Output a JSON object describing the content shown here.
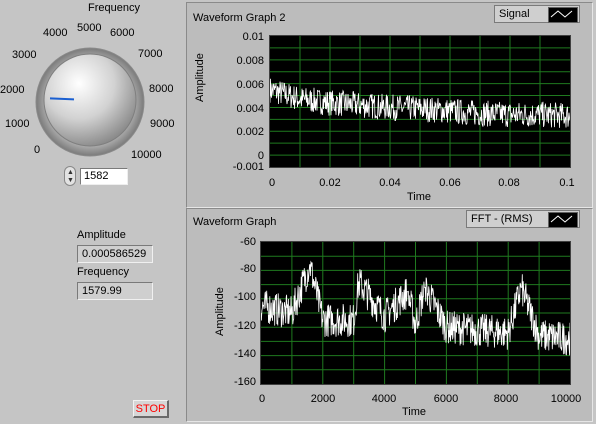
{
  "knob": {
    "label": "Frequency",
    "scale": [
      "0",
      "1000",
      "2000",
      "3000",
      "4000",
      "5000",
      "6000",
      "7000",
      "8000",
      "9000",
      "10000"
    ],
    "value": 1582,
    "control_value": "1582"
  },
  "indicators": {
    "amplitude_label": "Amplitude",
    "amplitude_value": "0.000586529",
    "frequency_label": "Frequency",
    "frequency_value": "1579.99"
  },
  "stop_label": "STOP",
  "graph1": {
    "title": "Waveform Graph 2",
    "legend": "Signal",
    "ylabel": "Amplitude",
    "xlabel": "Time",
    "yticks": [
      "0.01",
      "0.008",
      "0.006",
      "0.004",
      "0.002",
      "0",
      "-0.001"
    ],
    "xticks": [
      "0",
      "0.02",
      "0.04",
      "0.06",
      "0.08",
      "0.1"
    ]
  },
  "graph2": {
    "title": "Waveform Graph",
    "legend": "FFT - (RMS)",
    "ylabel": "Amplitude",
    "xlabel": "Time",
    "yticks": [
      "-60",
      "-80",
      "-100",
      "-120",
      "-140",
      "-160"
    ],
    "xticks": [
      "0",
      "2000",
      "4000",
      "6000",
      "8000",
      "10000"
    ]
  },
  "colors": {
    "plot_bg": "#000000",
    "grid": "#1f7a1f",
    "trace": "#ffffff",
    "panel": "#c5c5c5",
    "knob_pointer": "#1a5fd1",
    "stop_text": "#ff0000"
  },
  "chart_data": [
    {
      "type": "line",
      "title": "Waveform Graph 2",
      "xlabel": "Time",
      "ylabel": "Amplitude",
      "xlim": [
        0,
        0.1
      ],
      "ylim": [
        -0.001,
        0.01
      ],
      "grid": true,
      "series": [
        {
          "name": "Signal",
          "x": [
            0,
            0.01,
            0.02,
            0.03,
            0.04,
            0.05,
            0.06,
            0.07,
            0.08,
            0.09,
            0.1
          ],
          "y": [
            0.0055,
            0.0047,
            0.0044,
            0.0042,
            0.004,
            0.0039,
            0.0037,
            0.0035,
            0.0034,
            0.0034,
            0.0033
          ]
        }
      ]
    },
    {
      "type": "line",
      "title": "Waveform Graph",
      "xlabel": "Time",
      "ylabel": "Amplitude",
      "xlim": [
        0,
        10000
      ],
      "ylim": [
        -160,
        -60
      ],
      "grid": true,
      "series": [
        {
          "name": "FFT - (RMS)",
          "x": [
            0,
            1000,
            1580,
            2000,
            3000,
            3160,
            4000,
            4740,
            5000,
            5300,
            6000,
            7000,
            8000,
            8420,
            9000,
            10000
          ],
          "y": [
            -105,
            -110,
            -76,
            -115,
            -115,
            -88,
            -112,
            -95,
            -118,
            -92,
            -120,
            -122,
            -124,
            -92,
            -126,
            -128
          ]
        }
      ]
    }
  ]
}
